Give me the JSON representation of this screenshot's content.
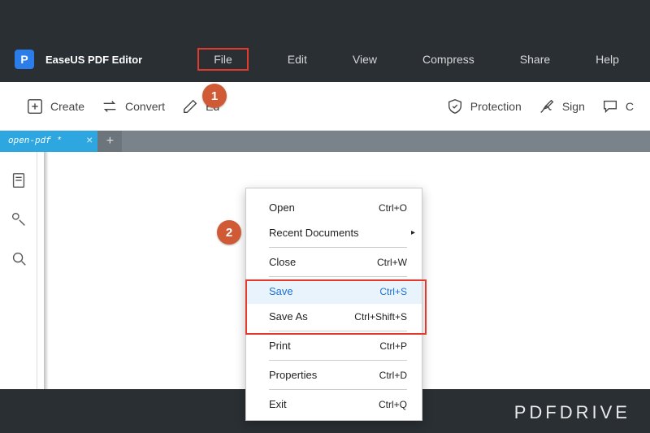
{
  "app": {
    "title": "EaseUS PDF Editor"
  },
  "menu": {
    "file": "File",
    "edit": "Edit",
    "view": "View",
    "compress": "Compress",
    "share": "Share",
    "help": "Help"
  },
  "toolbar": {
    "create": "Create",
    "convert": "Convert",
    "edit": "Ed",
    "protection": "Protection",
    "sign": "Sign",
    "comment": "C"
  },
  "tab": {
    "name": "open-pdf *",
    "close": "×",
    "add": "+"
  },
  "dropdown": {
    "open": {
      "label": "Open",
      "shortcut": "Ctrl+O"
    },
    "recent": {
      "label": "Recent Documents",
      "shortcut": ""
    },
    "close": {
      "label": "Close",
      "shortcut": "Ctrl+W"
    },
    "save": {
      "label": "Save",
      "shortcut": "Ctrl+S"
    },
    "saveas": {
      "label": "Save As",
      "shortcut": "Ctrl+Shift+S"
    },
    "print": {
      "label": "Print",
      "shortcut": "Ctrl+P"
    },
    "props": {
      "label": "Properties",
      "shortcut": "Ctrl+D"
    },
    "exit": {
      "label": "Exit",
      "shortcut": "Ctrl+Q"
    }
  },
  "callouts": {
    "one": "1",
    "two": "2"
  },
  "brand": "PDFDRIVE"
}
